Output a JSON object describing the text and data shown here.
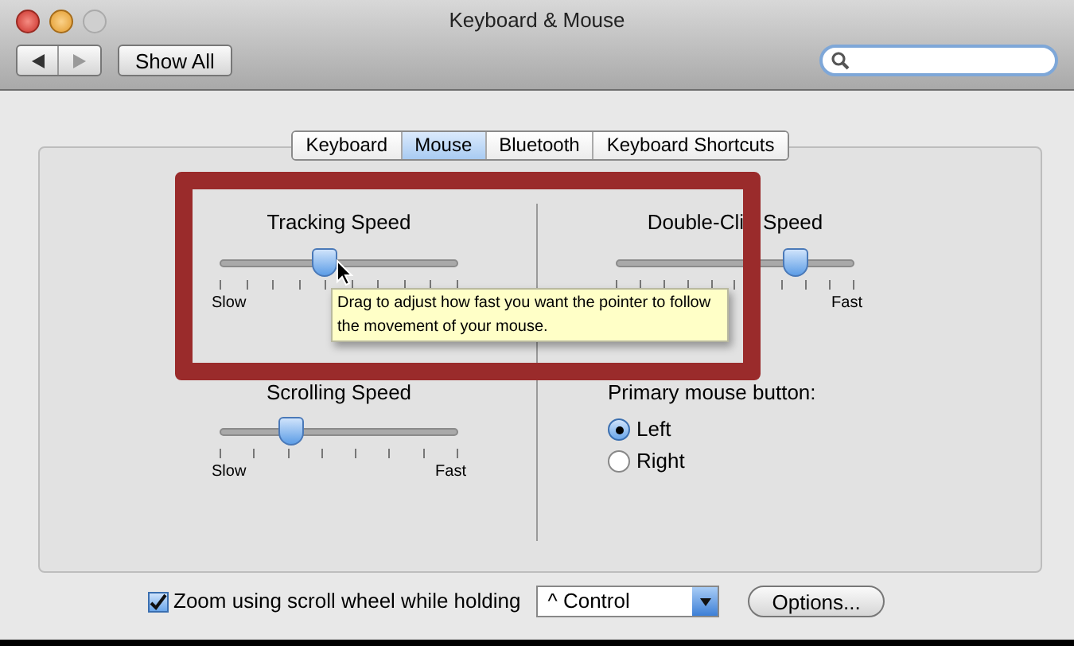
{
  "window": {
    "title": "Keyboard & Mouse"
  },
  "toolbar": {
    "show_all": "Show All"
  },
  "tabs": [
    {
      "label": "Keyboard",
      "selected": false
    },
    {
      "label": "Mouse",
      "selected": true
    },
    {
      "label": "Bluetooth",
      "selected": false
    },
    {
      "label": "Keyboard Shortcuts",
      "selected": false
    }
  ],
  "tracking": {
    "title": "Tracking Speed",
    "level": 0.44,
    "min_label": "Slow"
  },
  "double_click": {
    "title_part_1": "Double-Cli",
    "title_part_2": "Speed",
    "level": 0.76,
    "max_label": "Fast"
  },
  "scrolling": {
    "title": "Scrolling Speed",
    "level": 0.3,
    "min_label": "Slow",
    "max_label": "Fast"
  },
  "primary_button": {
    "label": "Primary mouse button:",
    "options": [
      {
        "label": "Left",
        "selected": true
      },
      {
        "label": "Right",
        "selected": false
      }
    ]
  },
  "zoom": {
    "label": "Zoom using scroll wheel while holding",
    "checked": true,
    "modifier": "^ Control",
    "options_button": "Options..."
  },
  "tooltip": "Drag to adjust how fast you want the pointer to follow the movement of your mouse."
}
